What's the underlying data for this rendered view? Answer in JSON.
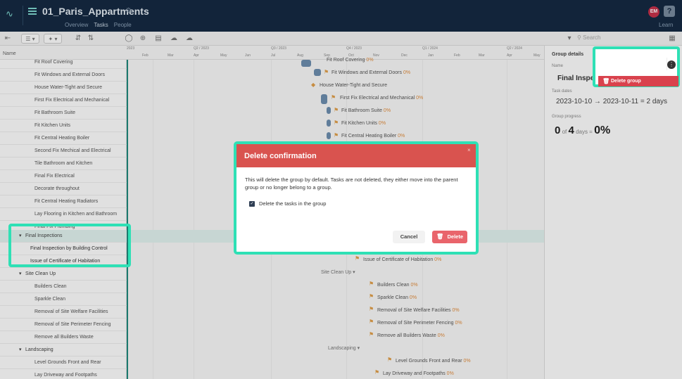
{
  "app": {
    "title": "01_Paris_Appartments",
    "tabs": [
      "Overview",
      "Tasks",
      "People"
    ],
    "avatar": "EM",
    "help": "?",
    "learn": "Learn"
  },
  "toolbar": {
    "search_placeholder": "Search"
  },
  "header": {
    "name_col": "Name",
    "quarters": [
      "2023",
      "Q2 / 2023",
      "Q3 / 2023",
      "Q4 / 2023",
      "Q1 / 2024",
      "Q2 / 2024"
    ],
    "months": [
      "Feb",
      "Mar",
      "Apr",
      "May",
      "Jun",
      "Jul",
      "Aug",
      "Sep",
      "Oct",
      "Nov",
      "Dec",
      "Jan",
      "Feb",
      "Mar",
      "Apr",
      "May"
    ]
  },
  "rows": [
    {
      "label": "Fit Roof Covering",
      "type": "task"
    },
    {
      "label": "Fit Windows and External Doors",
      "type": "task"
    },
    {
      "label": "House Water-Tight and Secure",
      "type": "task"
    },
    {
      "label": "First Fix Electrical and Mechanical",
      "type": "task"
    },
    {
      "label": "Fit Bathroom Suite",
      "type": "task"
    },
    {
      "label": "Fit Kitchen Units",
      "type": "task"
    },
    {
      "label": "Fit Central Heating Boiler",
      "type": "task"
    },
    {
      "label": "Second Fix Mechical and Electrical",
      "type": "task"
    },
    {
      "label": "Tile Bathroom and Kitchen",
      "type": "task"
    },
    {
      "label": "Final Fix Electrical",
      "type": "task"
    },
    {
      "label": "Decorate throughout",
      "type": "task"
    },
    {
      "label": "Fit Central Heating Radiators",
      "type": "task"
    },
    {
      "label": "Lay Flooring in Kitchen and Bathroom",
      "type": "task"
    },
    {
      "label": "Final Fix Plumbing",
      "type": "task"
    },
    {
      "label": "Final Inspections",
      "type": "group"
    },
    {
      "label": "Final Inspection by Building Control",
      "type": "task"
    },
    {
      "label": "Issue of Certificate of Habitation",
      "type": "task"
    },
    {
      "label": "Site Clean Up",
      "type": "group"
    },
    {
      "label": "Builders Clean",
      "type": "task"
    },
    {
      "label": "Sparkle Clean",
      "type": "task"
    },
    {
      "label": "Removal of Site Welfare Facilities",
      "type": "task"
    },
    {
      "label": "Removal of Site Perimeter Fencing",
      "type": "task"
    },
    {
      "label": "Remove all Builders Waste",
      "type": "task"
    },
    {
      "label": "Landscaping",
      "type": "group"
    },
    {
      "label": "Level Grounds Front and Rear",
      "type": "task"
    },
    {
      "label": "Lay Driveway and Footpaths",
      "type": "task"
    }
  ],
  "gantt_labels": {
    "roof": "Fit Roof Covering",
    "windows": "Fit Windows and External Doors",
    "house": "House Water-Tight and Secure",
    "first_fix": "First Fix Electrical and Mechanical",
    "bathroom": "Fit Bathroom Suite",
    "kitchen": "Fit Kitchen Units",
    "boiler": "Fit Central Heating Boiler",
    "certificate": "Issue of Certificate of Habitation",
    "site_group": "Site Clean Up",
    "builders": "Builders Clean",
    "sparkle": "Sparkle Clean",
    "welfare": "Removal of Site Welfare Facilities",
    "fencing": "Removal of Site Perimeter Fencing",
    "waste": "Remove all Builders Waste",
    "land_group": "Landscaping",
    "grounds": "Level Grounds Front and Rear",
    "driveway": "Lay Driveway and Footpaths",
    "pct": "0%"
  },
  "right_panel": {
    "title": "Group details",
    "name_label": "Name",
    "name_value": "Final Inspe",
    "name_value_tail": "ti",
    "dates_label": "Task dates",
    "dates_value": "2023-10-10 → 2023-10-11 = 2 days",
    "progress_label": "Group progress",
    "progress_done": "0",
    "progress_of": "of",
    "progress_total": "4",
    "progress_days": "days =",
    "progress_pct": "0%"
  },
  "popup": {
    "delete_group": "Delete group"
  },
  "modal": {
    "title": "Delete confirmation",
    "close": "×",
    "body": "This will delete the group by default. Tasks are not deleted, they either move into the parent group or no longer belong to a group.",
    "checkbox_label": "Delete the tasks in the group",
    "checkbox_checked": true,
    "cancel": "Cancel",
    "delete": "Delete"
  },
  "colors": {
    "accent": "#2ee0b5",
    "topbar": "#152a43",
    "danger": "#d9534f"
  }
}
